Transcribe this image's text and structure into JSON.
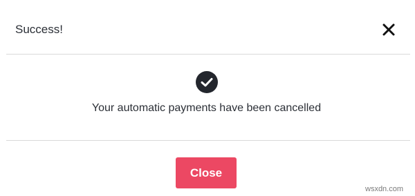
{
  "dialog": {
    "title": "Success!",
    "close_icon": "close-icon",
    "status_icon": "check-circle-icon",
    "message": "Your automatic payments have been cancelled",
    "close_button_label": "Close"
  },
  "watermark": "wsxdn.com",
  "colors": {
    "accent": "#ec4863",
    "text": "#2b2f36",
    "divider": "#d9d9d9",
    "icon": "#23262d"
  }
}
